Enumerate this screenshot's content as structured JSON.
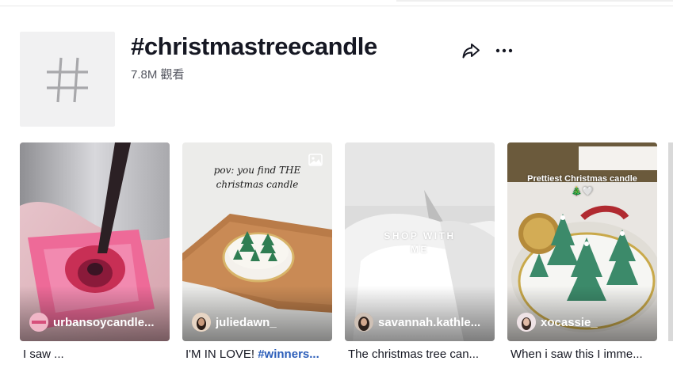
{
  "header": {
    "title": "#christmastreecandle",
    "views": "7.8M 觀看",
    "hash_symbol": "#"
  },
  "actions": {
    "share_icon": "share-arrow-icon",
    "more_icon": "more-dots-icon"
  },
  "videos": [
    {
      "author": "urbansoycandle...",
      "avatar_text": "URBAN SOY",
      "caption": "I saw ...",
      "caption_hashtag": ""
    },
    {
      "author": "juliedawn_",
      "overlay_line1": "pov: you find THE",
      "overlay_line2": "christmas candle",
      "caption": "I'M IN LOVE! ",
      "caption_hashtag": "#winners...",
      "badge_icon": "photo-icon"
    },
    {
      "author": "savannah.kathle...",
      "overlay_line1": "SHOP WITH",
      "overlay_line2": "ME",
      "caption": "The christmas tree can...",
      "caption_hashtag": ""
    },
    {
      "author": "xocassie_",
      "overlay_line1": "Prettiest Christmas candle",
      "overlay_line2": "🎄🤍",
      "caption": "When i saw this I imme...",
      "caption_hashtag": ""
    }
  ],
  "colors": {
    "hashtag_link": "#2b5db9",
    "title": "#161823",
    "secondary_text": "#555761",
    "tile_bg": "#f1f1f2"
  }
}
